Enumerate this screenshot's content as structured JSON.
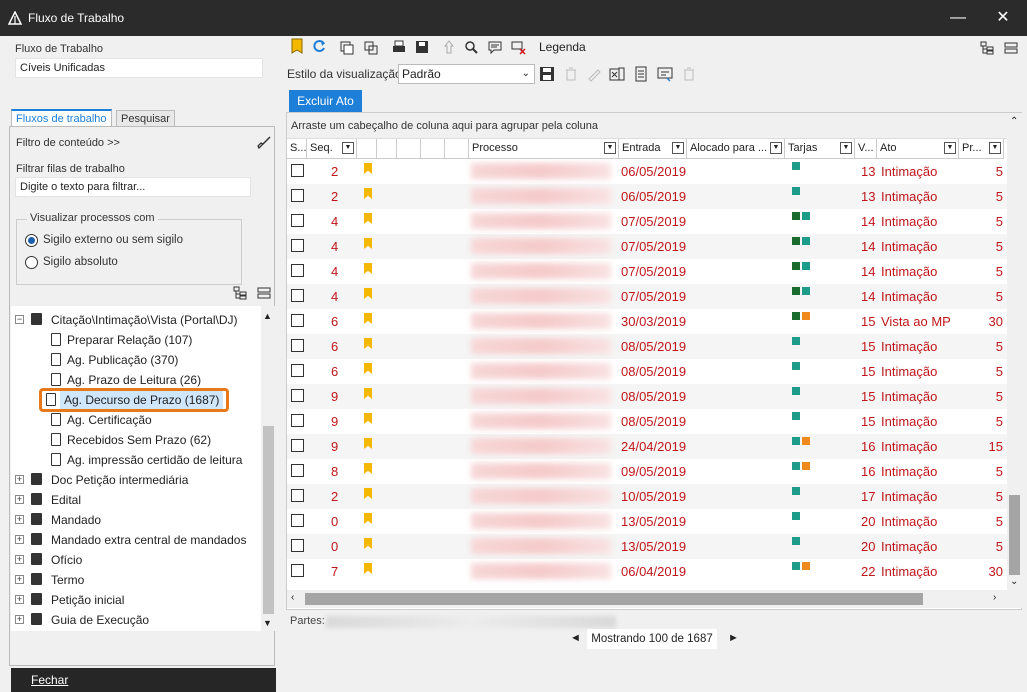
{
  "window": {
    "title": "Fluxo de Trabalho",
    "minimize": "—",
    "close": "✕"
  },
  "left": {
    "workflow_label": "Fluxo de Trabalho",
    "workflow_value": "Cíveis Unificadas",
    "tabs": [
      "Fluxos de trabalho",
      "Pesquisar"
    ],
    "content_filter": "Filtro de conteúdo >>",
    "filter_queues_label": "Filtrar filas de trabalho",
    "filter_placeholder": "Digite o texto para filtrar...",
    "visualize_group": "Visualizar processos com",
    "radios": [
      "Sigilo externo ou sem sigilo",
      "Sigilo absoluto"
    ],
    "tree": [
      {
        "label": "Citação\\Intimação\\Vista (Portal\\DJ)",
        "level": 0,
        "expander": "−"
      },
      {
        "label": "Preparar Relação (107)",
        "level": 1
      },
      {
        "label": "Ag. Publicação (370)",
        "level": 1
      },
      {
        "label": "Ag. Prazo de Leitura (26)",
        "level": 1
      },
      {
        "label": "Ag. Decurso de Prazo (1687)",
        "level": 1,
        "selected": true
      },
      {
        "label": "Ag. Certificação",
        "level": 1
      },
      {
        "label": "Recebidos Sem Prazo (62)",
        "level": 1
      },
      {
        "label": "Ag. impressão certidão de leitura",
        "level": 1
      },
      {
        "label": "Doc Petição intermediária",
        "level": 0,
        "expander": "+"
      },
      {
        "label": "Edital",
        "level": 0,
        "expander": "+"
      },
      {
        "label": "Mandado",
        "level": 0,
        "expander": "+"
      },
      {
        "label": "Mandado extra central de mandados",
        "level": 0,
        "expander": "+"
      },
      {
        "label": "Ofício",
        "level": 0,
        "expander": "+"
      },
      {
        "label": "Termo",
        "level": 0,
        "expander": "+"
      },
      {
        "label": "Petição inicial",
        "level": 0,
        "expander": "+"
      },
      {
        "label": "Guia de Execução",
        "level": 0,
        "expander": "+"
      }
    ],
    "close_button": "Fechar"
  },
  "toolbar": {
    "legend": "Legenda",
    "view_style_label": "Estilo da visualização",
    "view_style_value": "Padrão",
    "delete_act": "Excluir Ato"
  },
  "grid": {
    "group_hint": "Arraste um cabeçalho de coluna aqui para agrupar pela coluna",
    "columns": [
      "S...",
      "Seq.",
      "",
      "",
      "",
      "",
      "",
      "Processo",
      "Entrada",
      "Alocado para ...",
      "Tarjas",
      "V...",
      "Ato",
      "Pr..."
    ],
    "rows": [
      {
        "seq": "2",
        "entrada": "06/05/2019",
        "tarjas": [
          "#1e9c8a"
        ],
        "v": "13",
        "ato": "Intimação",
        "pr": "5"
      },
      {
        "seq": "2",
        "entrada": "06/05/2019",
        "tarjas": [
          "#1e9c8a"
        ],
        "v": "13",
        "ato": "Intimação",
        "pr": "5"
      },
      {
        "seq": "4",
        "entrada": "07/05/2019",
        "tarjas": [
          "#1a6b2e",
          "#1e9c8a"
        ],
        "v": "14",
        "ato": "Intimação",
        "pr": "5"
      },
      {
        "seq": "4",
        "entrada": "07/05/2019",
        "tarjas": [
          "#1a6b2e",
          "#1e9c8a"
        ],
        "v": "14",
        "ato": "Intimação",
        "pr": "5"
      },
      {
        "seq": "4",
        "entrada": "07/05/2019",
        "tarjas": [
          "#1a6b2e",
          "#1e9c8a"
        ],
        "v": "14",
        "ato": "Intimação",
        "pr": "5"
      },
      {
        "seq": "4",
        "entrada": "07/05/2019",
        "tarjas": [
          "#1a6b2e",
          "#1e9c8a"
        ],
        "v": "14",
        "ato": "Intimação",
        "pr": "5"
      },
      {
        "seq": "6",
        "entrada": "30/03/2019",
        "tarjas": [
          "#1a6b2e",
          "#f08a1c"
        ],
        "v": "15",
        "ato": "Vista ao MP",
        "pr": "30"
      },
      {
        "seq": "6",
        "entrada": "08/05/2019",
        "tarjas": [
          "#1e9c8a"
        ],
        "v": "15",
        "ato": "Intimação",
        "pr": "5"
      },
      {
        "seq": "6",
        "entrada": "08/05/2019",
        "tarjas": [
          "#1e9c8a"
        ],
        "v": "15",
        "ato": "Intimação",
        "pr": "5"
      },
      {
        "seq": "9",
        "entrada": "08/05/2019",
        "tarjas": [
          "#1e9c8a"
        ],
        "v": "15",
        "ato": "Intimação",
        "pr": "5"
      },
      {
        "seq": "9",
        "entrada": "08/05/2019",
        "tarjas": [
          "#1e9c8a"
        ],
        "v": "15",
        "ato": "Intimação",
        "pr": "5"
      },
      {
        "seq": "9",
        "entrada": "24/04/2019",
        "tarjas": [
          "#1e9c8a",
          "#f08a1c"
        ],
        "v": "16",
        "ato": "Intimação",
        "pr": "15"
      },
      {
        "seq": "8",
        "entrada": "09/05/2019",
        "tarjas": [
          "#1e9c8a",
          "#f08a1c"
        ],
        "v": "16",
        "ato": "Intimação",
        "pr": "5"
      },
      {
        "seq": "2",
        "entrada": "10/05/2019",
        "tarjas": [
          "#1e9c8a"
        ],
        "v": "17",
        "ato": "Intimação",
        "pr": "5"
      },
      {
        "seq": "0",
        "entrada": "13/05/2019",
        "tarjas": [
          "#1e9c8a"
        ],
        "v": "20",
        "ato": "Intimação",
        "pr": "5"
      },
      {
        "seq": "0",
        "entrada": "13/05/2019",
        "tarjas": [
          "#1e9c8a"
        ],
        "v": "20",
        "ato": "Intimação",
        "pr": "5"
      },
      {
        "seq": "7",
        "entrada": "06/04/2019",
        "tarjas": [
          "#1e9c8a",
          "#f08a1c"
        ],
        "v": "22",
        "ato": "Intimação",
        "pr": "30"
      }
    ]
  },
  "status": {
    "partes_label": "Partes:",
    "showing": "Mostrando 100 de 1687",
    "prev": "◄",
    "next": "►"
  },
  "colors": {
    "accent": "#1e7fd8",
    "row_text": "#c0161a",
    "selected_outline": "#e8791b"
  }
}
